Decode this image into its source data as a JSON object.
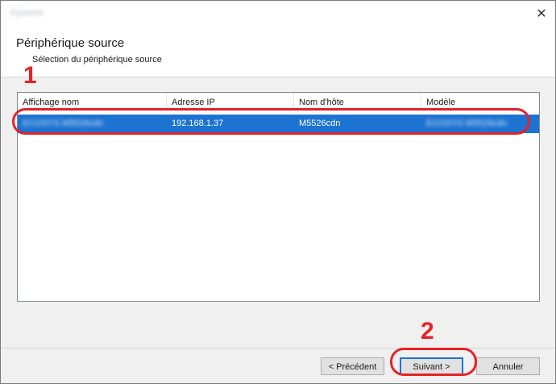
{
  "window": {
    "title": "Kyocera",
    "close_icon": "close-icon",
    "close_glyph": "✕"
  },
  "header": {
    "title": "Périphérique source",
    "subtitle": "Sélection du périphérique source"
  },
  "annotations": {
    "step1": "1",
    "step2": "2",
    "color": "#e4222a"
  },
  "table": {
    "columns": [
      "Affichage nom",
      "Adresse IP",
      "Nom d'hôte",
      "Modèle"
    ],
    "rows": [
      {
        "display_name": "ECOSYS M5526cdn",
        "ip_address": "192.168.1.37",
        "host_name": "M5526cdn",
        "model": "ECOSYS M5526cdn"
      }
    ]
  },
  "buttons": {
    "previous": "< Précédent",
    "next": "Suivant >",
    "cancel": "Annuler"
  },
  "colors": {
    "selection": "#1c73d2",
    "frame": "#f0f0f0"
  }
}
